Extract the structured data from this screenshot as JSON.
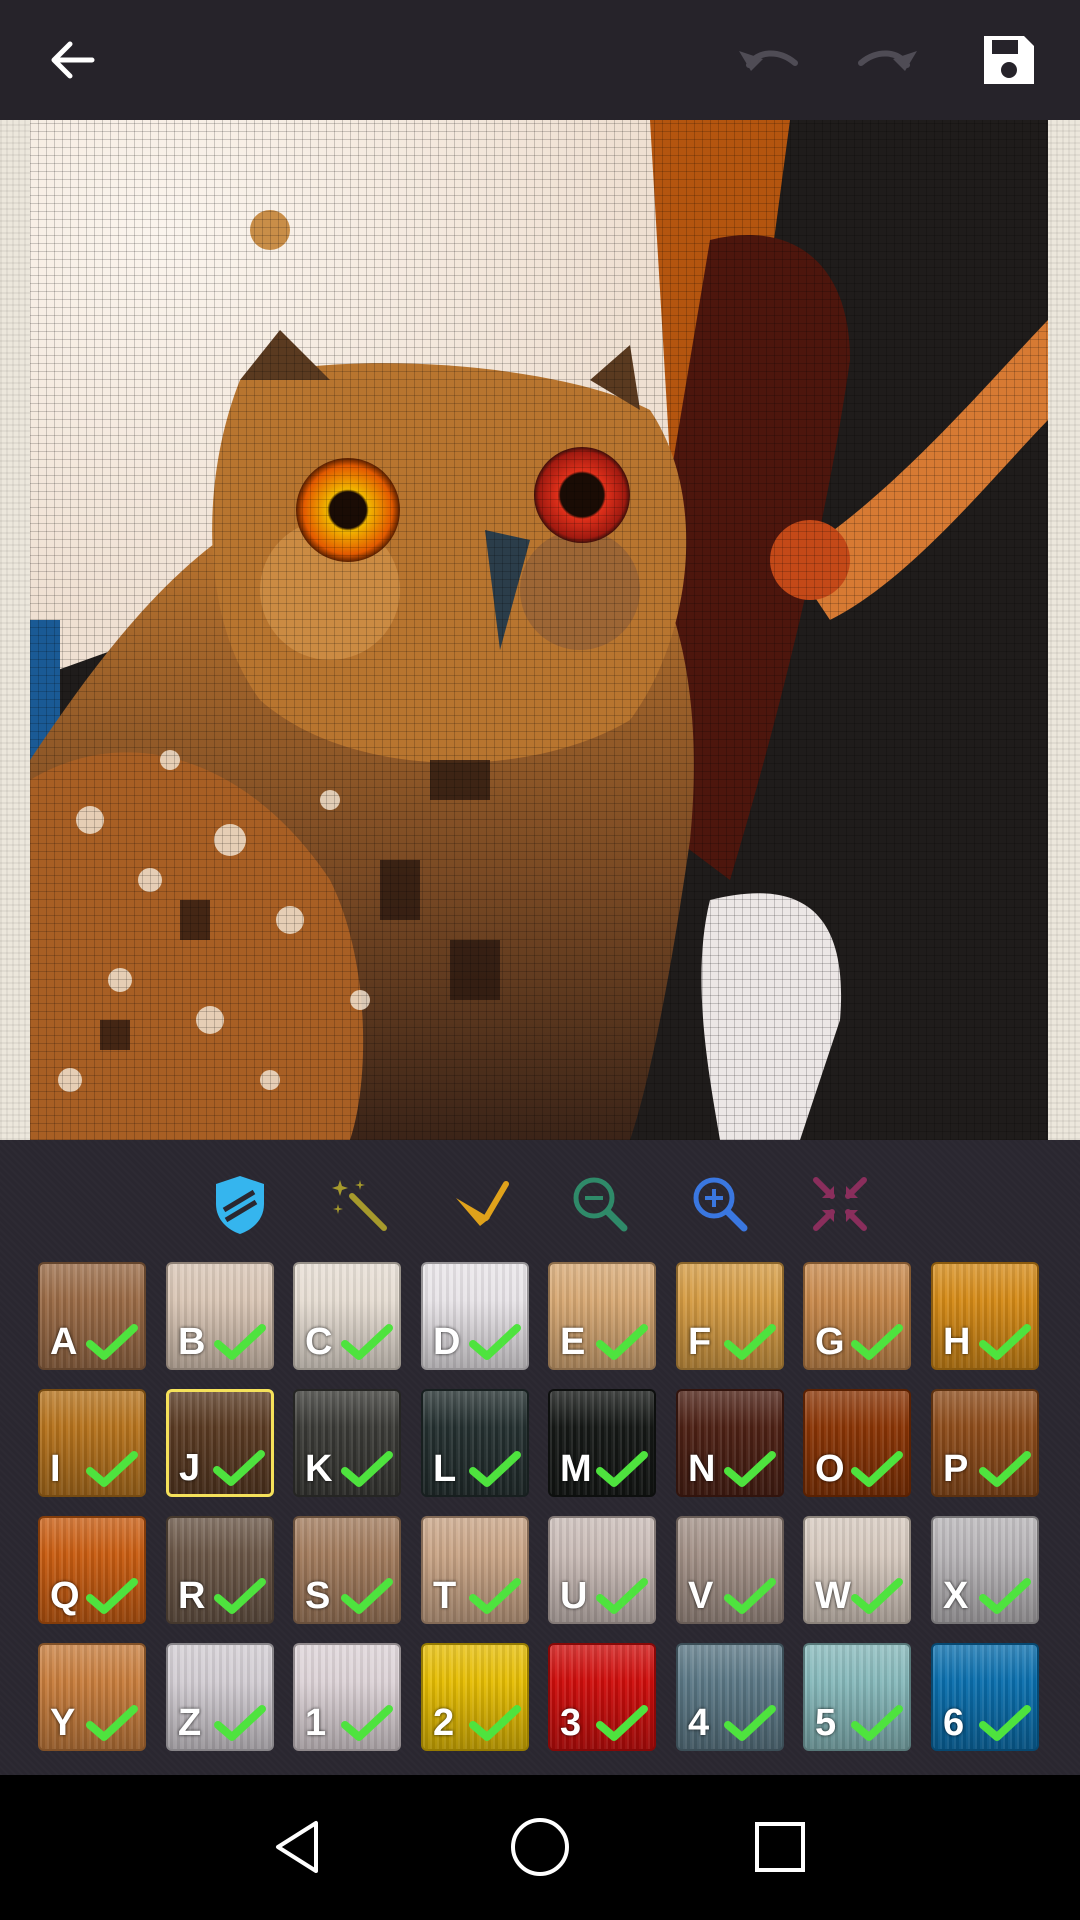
{
  "app": {
    "toolbar": {
      "back": "back-arrow-icon",
      "undo": "undo-icon",
      "redo": "redo-icon",
      "save": "save-icon"
    }
  },
  "tools": [
    {
      "name": "shield-tool-icon",
      "color": "#35b5ee"
    },
    {
      "name": "magic-wand-icon",
      "color": "#a69a2c"
    },
    {
      "name": "pen-applicator-icon",
      "color": "#e0a21b"
    },
    {
      "name": "zoom-out-icon",
      "color": "#2f8a69"
    },
    {
      "name": "zoom-in-icon",
      "color": "#3a77e0"
    },
    {
      "name": "fit-screen-icon",
      "color": "#8a2e5c"
    }
  ],
  "palette": [
    {
      "label": "A",
      "color": "#9a6a45",
      "checked": true
    },
    {
      "label": "B",
      "color": "#d9c5b4",
      "checked": true
    },
    {
      "label": "C",
      "color": "#e6ddd2",
      "checked": true
    },
    {
      "label": "D",
      "color": "#e8e4e8",
      "checked": true
    },
    {
      "label": "E",
      "color": "#d7a873",
      "checked": true
    },
    {
      "label": "F",
      "color": "#d59b42",
      "checked": true
    },
    {
      "label": "G",
      "color": "#c8884a",
      "checked": true
    },
    {
      "label": "H",
      "color": "#d58a16",
      "checked": true
    },
    {
      "label": "I",
      "color": "#b6731c",
      "checked": true
    },
    {
      "label": "J",
      "color": "#5a3a22",
      "checked": true,
      "selected": true
    },
    {
      "label": "K",
      "color": "#3a3a36",
      "checked": true
    },
    {
      "label": "L",
      "color": "#243030",
      "checked": true
    },
    {
      "label": "M",
      "color": "#151816",
      "checked": true
    },
    {
      "label": "N",
      "color": "#4d2014",
      "checked": true
    },
    {
      "label": "O",
      "color": "#8a3404",
      "checked": true
    },
    {
      "label": "P",
      "color": "#8e4c1a",
      "checked": true
    },
    {
      "label": "Q",
      "color": "#c95c10",
      "checked": true
    },
    {
      "label": "R",
      "color": "#6a5646",
      "checked": true
    },
    {
      "label": "S",
      "color": "#a27b5c",
      "checked": true
    },
    {
      "label": "T",
      "color": "#c9a485",
      "checked": true
    },
    {
      "label": "U",
      "color": "#c9bbb6",
      "checked": true
    },
    {
      "label": "V",
      "color": "#a29086",
      "checked": true
    },
    {
      "label": "W",
      "color": "#d6c9be",
      "checked": true
    },
    {
      "label": "X",
      "color": "#b7b4b7",
      "checked": true
    },
    {
      "label": "Y",
      "color": "#c87d3c",
      "checked": true
    },
    {
      "label": "Z",
      "color": "#d2cdd3",
      "checked": true
    },
    {
      "label": "1",
      "color": "#ddd3d7",
      "checked": true
    },
    {
      "label": "2",
      "color": "#e6bd02",
      "checked": true
    },
    {
      "label": "3",
      "color": "#cf0d0b",
      "checked": true
    },
    {
      "label": "4",
      "color": "#5b7886",
      "checked": true
    },
    {
      "label": "5",
      "color": "#86b9bb",
      "checked": true
    },
    {
      "label": "6",
      "color": "#0a6fae",
      "checked": true
    }
  ],
  "system_nav": {
    "back": "nav-back-icon",
    "home": "nav-home-icon",
    "recents": "nav-recents-icon"
  }
}
